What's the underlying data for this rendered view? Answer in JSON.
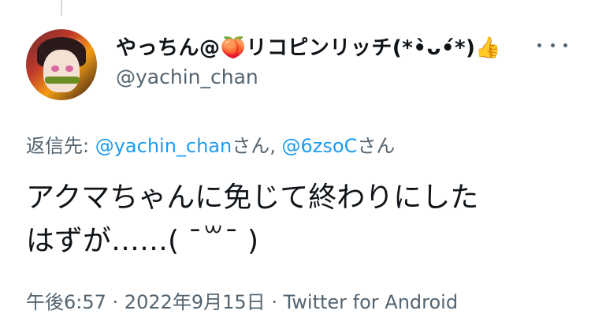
{
  "tweet": {
    "display_name": "やっちん@🍑リコピンリッチ(*•̀ᴗ•́*)👍",
    "handle": "@yachin_chan",
    "reply_prefix": "返信先: ",
    "reply_mentions": [
      {
        "handle": "@yachin_chan",
        "suffix": "さん"
      },
      {
        "handle": "@6zsoC",
        "suffix": "さん"
      }
    ],
    "reply_separator": ", ",
    "text": "アクマちゃんに免じて終わりにした\nはずが……( ˉ꒳ˉ )",
    "time": "午後6:57",
    "date": "2022年9月15日",
    "source": "Twitter for Android",
    "meta_separator": " · "
  },
  "icons": {
    "more": "more-dots-icon",
    "avatar": "user-avatar"
  }
}
